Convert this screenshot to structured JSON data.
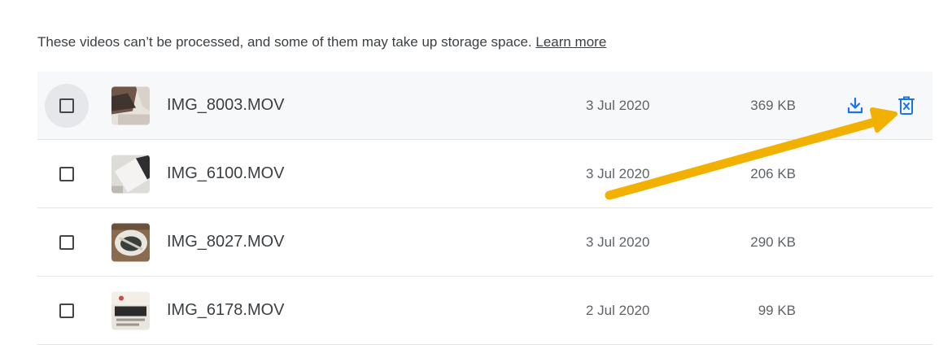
{
  "notice": {
    "text": "These videos can’t be processed, and some of them may take up storage space.",
    "link": "Learn more"
  },
  "colors": {
    "accent": "#1a73e8",
    "arrow": "#f2b100",
    "text": "#3c4043",
    "muted": "#5f6368"
  },
  "icons": {
    "download": "download-icon",
    "delete": "delete-icon"
  },
  "videos": [
    {
      "name": "IMG_8003.MOV",
      "date": "3 Jul 2020",
      "size": "369 KB",
      "hovered": true
    },
    {
      "name": "IMG_6100.MOV",
      "date": "3 Jul 2020",
      "size": "206 KB",
      "hovered": false
    },
    {
      "name": "IMG_8027.MOV",
      "date": "3 Jul 2020",
      "size": "290 KB",
      "hovered": false
    },
    {
      "name": "IMG_6178.MOV",
      "date": "2 Jul 2020",
      "size": "99 KB",
      "hovered": false
    }
  ]
}
